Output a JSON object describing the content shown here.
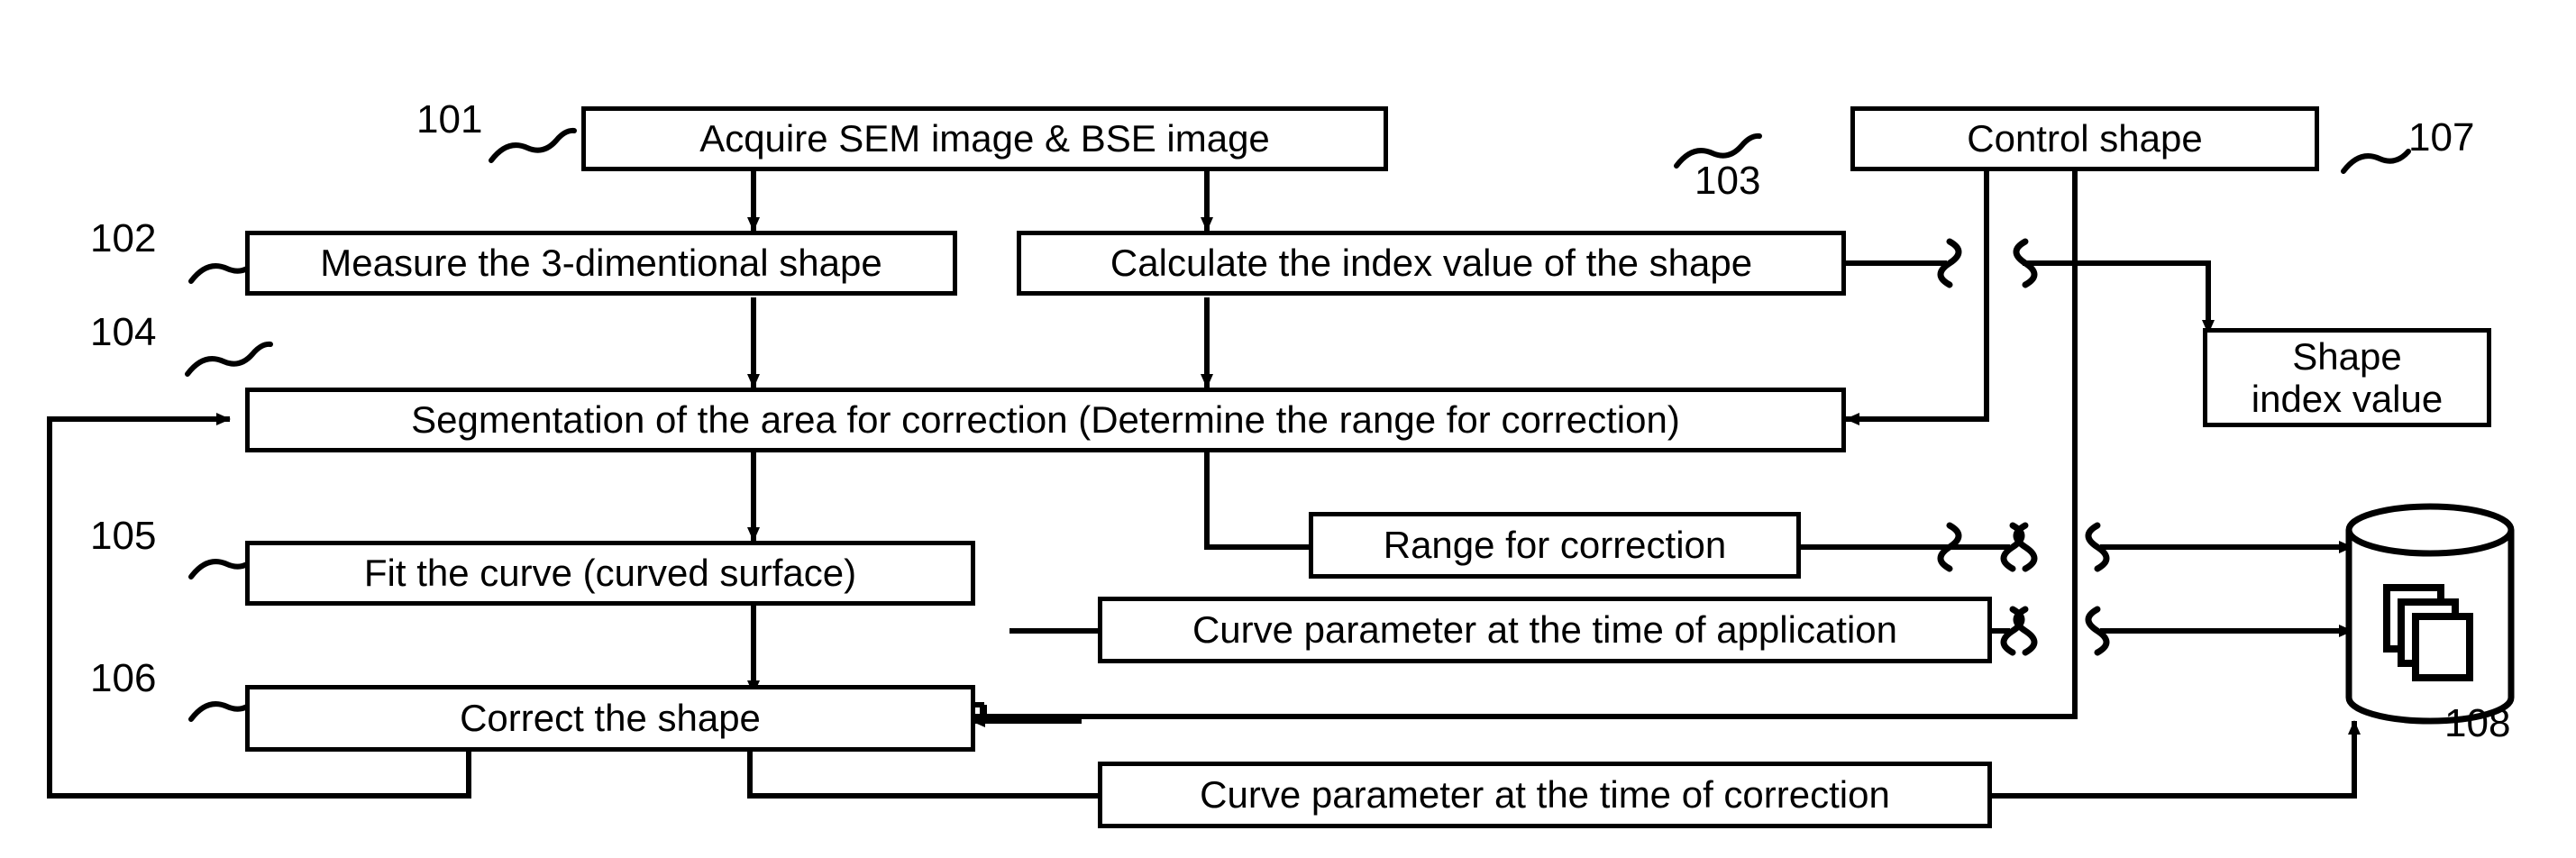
{
  "figure": {
    "type": "patent-flowchart",
    "title": "",
    "background_color": "#ffffff",
    "line_color": "#000000"
  },
  "boxes": [
    {
      "id": "acquire",
      "label": "Acquire SEM image & BSE image",
      "ref": "101"
    },
    {
      "id": "measure",
      "label": "Measure the 3-dimentional shape",
      "ref": "102"
    },
    {
      "id": "calculate",
      "label": "Calculate the index value of the shape",
      "ref": "103"
    },
    {
      "id": "segmentation",
      "label": "Segmentation of the area for correction (Determine the range for correction)",
      "ref": "104"
    },
    {
      "id": "fit-curve",
      "label": "Fit the curve (curved surface)",
      "ref": "105"
    },
    {
      "id": "correct-shape",
      "label": "Correct the shape",
      "ref": "106"
    },
    {
      "id": "control-shape",
      "label": "Control shape",
      "ref": "107"
    },
    {
      "id": "range-for-correction",
      "label": "Range for correction",
      "ref": ""
    },
    {
      "id": "curve-param-application",
      "label": "Curve parameter at the time of application",
      "ref": ""
    },
    {
      "id": "curve-param-correction",
      "label": "Curve parameter at the time of correction",
      "ref": ""
    },
    {
      "id": "shape-index-value",
      "label_line1": "Shape",
      "label_line2": "index value",
      "ref": ""
    }
  ],
  "database": {
    "id": "database",
    "ref": "108",
    "icon": "stacked-documents-icon"
  },
  "ref_labels": {
    "r101": "101",
    "r102": "102",
    "r103": "103",
    "r104": "104",
    "r105": "105",
    "r106": "106",
    "r107": "107",
    "r108": "108"
  }
}
